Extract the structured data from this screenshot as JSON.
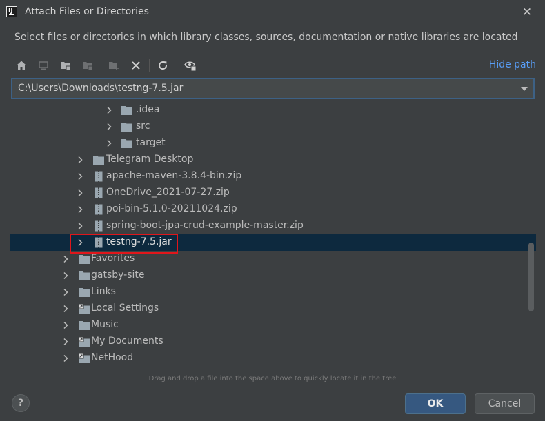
{
  "window": {
    "title": "Attach Files or Directories",
    "close_glyph": "✕"
  },
  "description": "Select files or directories in which library classes, sources, documentation or native libraries are located",
  "toolbar": {
    "icons": [
      "home-icon",
      "desktop-icon",
      "project-folder-icon",
      "module-folder-icon",
      "new-folder-icon",
      "delete-icon",
      "refresh-icon",
      "show-hidden-icon"
    ],
    "hide_path": "Hide path"
  },
  "path": {
    "value": "C:\\Users\\Downloads\\testng-7.5.jar"
  },
  "tree": {
    "rows": [
      {
        "label": ".idea",
        "icon": "folder",
        "level": 2,
        "selected": false
      },
      {
        "label": "src",
        "icon": "folder",
        "level": 2,
        "selected": false
      },
      {
        "label": "target",
        "icon": "folder",
        "level": 2,
        "selected": false
      },
      {
        "label": "Telegram Desktop",
        "icon": "folder",
        "level": 1,
        "selected": false
      },
      {
        "label": "apache-maven-3.8.4-bin.zip",
        "icon": "archive",
        "level": 1,
        "selected": false
      },
      {
        "label": "OneDrive_2021-07-27.zip",
        "icon": "archive",
        "level": 1,
        "selected": false
      },
      {
        "label": "poi-bin-5.1.0-20211024.zip",
        "icon": "archive",
        "level": 1,
        "selected": false
      },
      {
        "label": "spring-boot-jpa-crud-example-master.zip",
        "icon": "archive",
        "level": 1,
        "selected": false
      },
      {
        "label": "testng-7.5.jar",
        "icon": "archive",
        "level": 1,
        "selected": true
      },
      {
        "label": "Favorites",
        "icon": "folder",
        "level": 0,
        "selected": false
      },
      {
        "label": "gatsby-site",
        "icon": "folder",
        "level": 0,
        "selected": false
      },
      {
        "label": "Links",
        "icon": "folder",
        "level": 0,
        "selected": false
      },
      {
        "label": "Local Settings",
        "icon": "folder-link",
        "level": 0,
        "selected": false
      },
      {
        "label": "Music",
        "icon": "folder",
        "level": 0,
        "selected": false
      },
      {
        "label": "My Documents",
        "icon": "folder-link",
        "level": 0,
        "selected": false
      },
      {
        "label": "NetHood",
        "icon": "folder-link",
        "level": 0,
        "selected": false
      }
    ]
  },
  "hint": "Drag and drop a file into the space above to quickly locate it in the tree",
  "buttons": {
    "help": "?",
    "ok": "OK",
    "cancel": "Cancel"
  },
  "colors": {
    "background": "#3c3f41",
    "selection": "#0d293e",
    "accent": "#589df6",
    "highlight_border": "#e0161b",
    "ok_button": "#365880"
  }
}
